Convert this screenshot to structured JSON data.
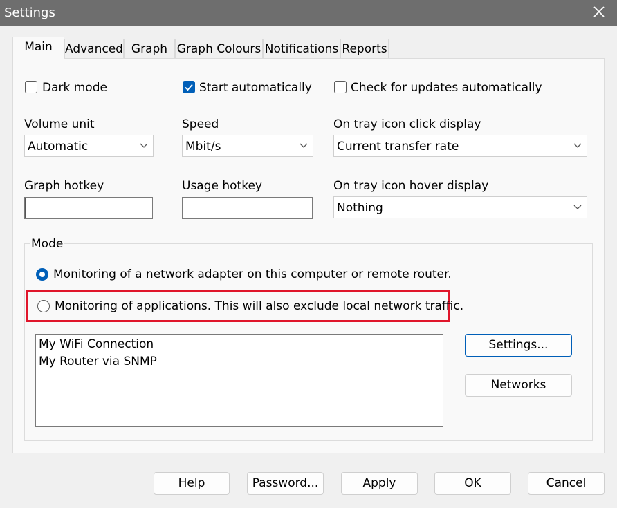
{
  "window": {
    "title": "Settings"
  },
  "tabs": [
    {
      "label": "Main"
    },
    {
      "label": "Advanced"
    },
    {
      "label": "Graph"
    },
    {
      "label": "Graph Colours"
    },
    {
      "label": "Notifications"
    },
    {
      "label": "Reports"
    }
  ],
  "options": {
    "dark_mode": {
      "label": "Dark mode",
      "checked": false
    },
    "start_auto": {
      "label": "Start automatically",
      "checked": true
    },
    "check_updates": {
      "label": "Check for updates automatically",
      "checked": false
    }
  },
  "fields": {
    "volume_unit": {
      "label": "Volume unit",
      "value": "Automatic"
    },
    "speed": {
      "label": "Speed",
      "value": "Mbit/s"
    },
    "tray_click": {
      "label": "On tray icon click display",
      "value": "Current transfer rate"
    },
    "graph_hotkey": {
      "label": "Graph hotkey",
      "value": ""
    },
    "usage_hotkey": {
      "label": "Usage hotkey",
      "value": ""
    },
    "tray_hover": {
      "label": "On tray icon hover display",
      "value": "Nothing"
    }
  },
  "mode": {
    "label": "Mode",
    "option_adapter": {
      "label": "Monitoring of a network adapter on this computer or remote router.",
      "selected": true
    },
    "option_apps": {
      "label": "Monitoring of applications. This will also exclude local network traffic.",
      "selected": false
    }
  },
  "connections": [
    "My WiFi Connection",
    "My Router via SNMP"
  ],
  "side_buttons": {
    "settings": "Settings...",
    "networks": "Networks"
  },
  "footer": {
    "help": "Help",
    "password": "Password...",
    "apply": "Apply",
    "ok": "OK",
    "cancel": "Cancel"
  },
  "colors": {
    "accent": "#005fb8",
    "highlight_border": "#e0162b",
    "titlebar": "#6e6e6e"
  },
  "icons": {
    "close": "close-icon",
    "chevron": "chevron-down-icon",
    "check": "checkmark-icon"
  }
}
